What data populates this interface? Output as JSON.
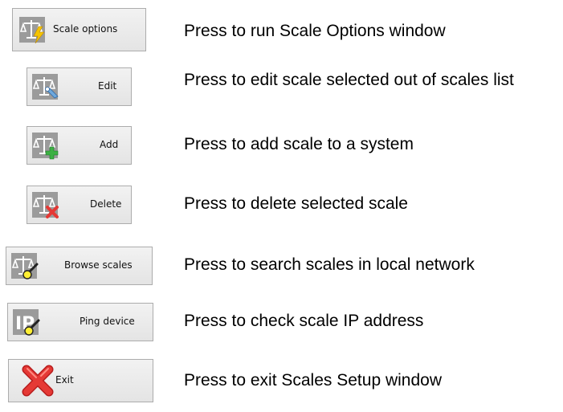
{
  "rows": [
    {
      "button_label": "Scale options",
      "icon": "scale-lightning-icon",
      "description": "Press to run Scale Options window"
    },
    {
      "button_label": "Edit",
      "icon": "scale-edit-icon",
      "description": "Press to edit scale selected out of scales list"
    },
    {
      "button_label": "Add",
      "icon": "scale-add-icon",
      "description": "Press to add scale to a system"
    },
    {
      "button_label": "Delete",
      "icon": "scale-delete-icon",
      "description": "Press to delete selected scale"
    },
    {
      "button_label": "Browse scales",
      "icon": "scale-search-icon",
      "description": "Press to search scales in local network"
    },
    {
      "button_label": "Ping device",
      "icon": "ip-search-icon",
      "description": "Press to check scale IP address"
    },
    {
      "button_label": "Exit",
      "icon": "red-x-icon",
      "description": "Press to exit Scales Setup window"
    }
  ],
  "colors": {
    "button_bg": "#e8e8e8",
    "button_border": "#acacac",
    "icon_gray": "#9b9b9b",
    "lightning": "#f5c400",
    "plus": "#3cb043",
    "x_red": "#e53935",
    "search_yellow": "#ffee33"
  }
}
